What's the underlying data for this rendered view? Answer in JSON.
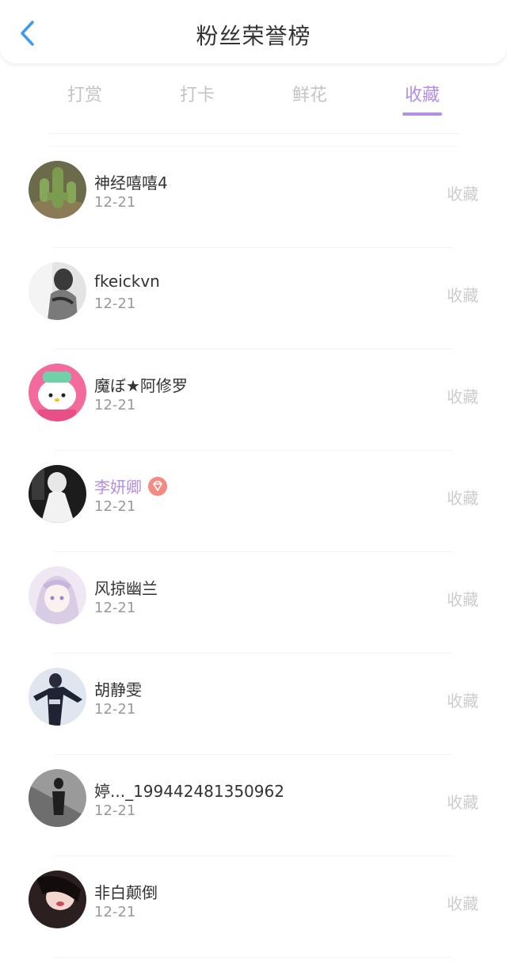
{
  "header": {
    "title": "粉丝荣誉榜",
    "back_icon": "chevron-left-icon",
    "accent": "#3d9be9"
  },
  "tabs": [
    {
      "label": "打赏",
      "active": false
    },
    {
      "label": "打卡",
      "active": false
    },
    {
      "label": "鲜花",
      "active": false
    },
    {
      "label": "收藏",
      "active": true
    }
  ],
  "colors": {
    "active_tab": "#b48ee0",
    "inactive_tab": "#c4c4c4",
    "vip_name": "#b48ee0",
    "vip_badge": "#f28b82"
  },
  "fans": [
    {
      "name": "神经嘻嘻4",
      "date": "12-21",
      "action": "收藏",
      "vip": false
    },
    {
      "name": "fkeickvn",
      "date": "12-21",
      "action": "收藏",
      "vip": false
    },
    {
      "name": "魔ぼ★阿修罗",
      "date": "12-21",
      "action": "收藏",
      "vip": false
    },
    {
      "name": "李妍卿",
      "date": "12-21",
      "action": "收藏",
      "vip": true,
      "badge_icon": "diamond-icon"
    },
    {
      "name": "风掠幽兰",
      "date": "12-21",
      "action": "收藏",
      "vip": false
    },
    {
      "name": "胡静雯",
      "date": "12-21",
      "action": "收藏",
      "vip": false
    },
    {
      "name": "婷..._199442481350962",
      "date": "12-21",
      "action": "收藏",
      "vip": false
    },
    {
      "name": "非白颠倒",
      "date": "12-21",
      "action": "收藏",
      "vip": false
    }
  ]
}
